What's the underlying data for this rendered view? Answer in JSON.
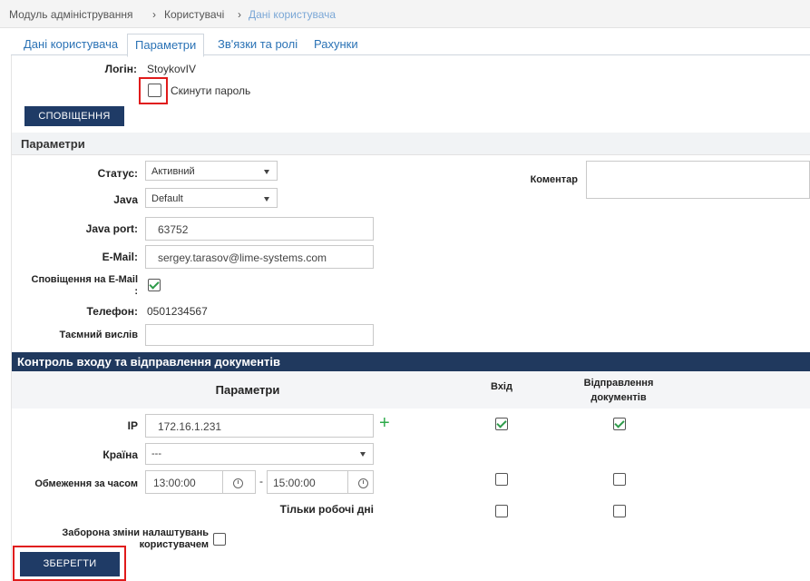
{
  "breadcrumb": {
    "items": [
      "Модуль адміністрування",
      "Користувачі",
      "Дані користувача"
    ],
    "separator": "›"
  },
  "tabs": [
    {
      "label": "Дані користувача",
      "active": false
    },
    {
      "label": "Параметри",
      "active": true
    },
    {
      "label": "Зв'язки та ролі",
      "active": false
    },
    {
      "label": "Рахунки",
      "active": false
    }
  ],
  "user": {
    "login_label": "Логін:",
    "login_value": "StoykovIV",
    "reset_password_label": "Скинути пароль",
    "reset_password_checked": false,
    "notifications_button": "СПОВІЩЕННЯ"
  },
  "params": {
    "section_title": "Параметри",
    "status_label": "Статус:",
    "status_value": "Активний",
    "java_label": "Java",
    "java_value": "Default",
    "java_port_label": "Java port:",
    "java_port_value": "63752",
    "email_label": "E-Mail:",
    "email_value": "sergey.tarasov@lime-systems.com",
    "email_notify_label_1": "Сповіщення на E-Mail",
    "email_notify_label_2": ":",
    "email_notify_checked": true,
    "phone_label": "Телефон:",
    "phone_value": "0501234567",
    "secret_label": "Таємний вислів",
    "secret_value": "",
    "comment_label": "Коментар"
  },
  "access": {
    "section_title": "Контроль входу та відправлення документів",
    "col_params": "Параметри",
    "col_login": "Вхід",
    "col_send_1": "Відправлення",
    "col_send_2": "документів",
    "ip_label": "IP",
    "ip_value": "172.16.1.231",
    "ip_login": true,
    "ip_send": true,
    "country_label": "Країна",
    "country_value": "---",
    "time_label": "Обмеження за часом",
    "time_from": "13:00:00",
    "time_dash": "-",
    "time_to": "15:00:00",
    "time_login": false,
    "time_send": false,
    "workdays_label": "Тільки робочі дні",
    "workdays_login": false,
    "workdays_send": false
  },
  "footer": {
    "forbid_label_1": "Заборона зміни налаштувань",
    "forbid_label_2": "користувачем",
    "forbid_checked": false,
    "save_button": "ЗБЕРЕГТИ"
  },
  "colors": {
    "accent_dark": "#20395e",
    "link": "#2a72b5",
    "check_green": "#2e9b4a",
    "highlight_red": "#e01b1b"
  }
}
